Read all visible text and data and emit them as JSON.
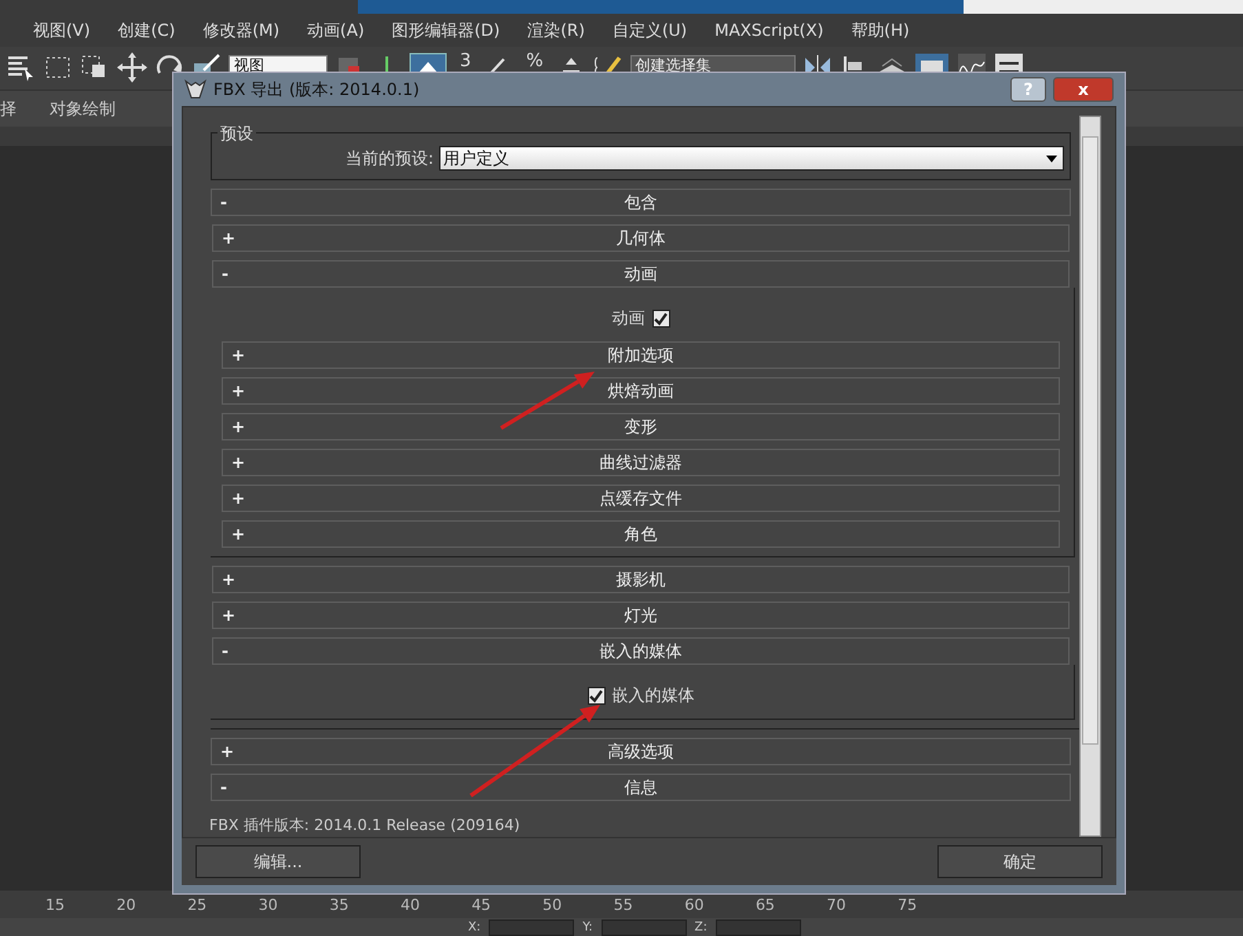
{
  "app": {
    "menu": [
      "视图(V)",
      "创建(C)",
      "修改器(M)",
      "动画(A)",
      "图形编辑器(D)",
      "渲染(R)",
      "自定义(U)",
      "MAXScript(X)",
      "帮助(H)"
    ],
    "toolbar": {
      "view_dropdown": "视图",
      "snap_label": "3",
      "percent_label": "%",
      "selection_set": "创建选择集"
    },
    "ribbon_tabs": [
      "择",
      "对象绘制"
    ],
    "ruler": [
      "15",
      "20",
      "25",
      "30",
      "35",
      "40",
      "45",
      "50",
      "55",
      "60",
      "65",
      "70",
      "75"
    ],
    "status_fields": [
      "X:",
      "Y:",
      "Z:"
    ]
  },
  "dialog": {
    "title": "FBX 导出 (版本: 2014.0.1)",
    "help": "?",
    "close": "x",
    "preset": {
      "group_label": "预设",
      "label": "当前的预设:",
      "value": "用户定义"
    },
    "rollouts": [
      {
        "toggle": "-",
        "title": "包含",
        "expanded": true,
        "children": [
          {
            "toggle": "+",
            "title": "几何体",
            "expanded": false
          },
          {
            "toggle": "-",
            "title": "动画",
            "expanded": true,
            "content": [
              {
                "kind": "trailingcheckbox",
                "label": "动画",
                "checked": true
              }
            ],
            "children": [
              {
                "toggle": "+",
                "title": "附加选项",
                "expanded": false
              },
              {
                "toggle": "+",
                "title": "烘焙动画",
                "expanded": false
              },
              {
                "toggle": "+",
                "title": "变形",
                "expanded": false
              },
              {
                "toggle": "+",
                "title": "曲线过滤器",
                "expanded": false
              },
              {
                "toggle": "+",
                "title": "点缓存文件",
                "expanded": false
              },
              {
                "toggle": "+",
                "title": "角色",
                "expanded": false
              }
            ]
          },
          {
            "toggle": "+",
            "title": "摄影机",
            "expanded": false
          },
          {
            "toggle": "+",
            "title": "灯光",
            "expanded": false
          },
          {
            "toggle": "-",
            "title": "嵌入的媒体",
            "expanded": true,
            "content": [
              {
                "kind": "checkbox",
                "label": "嵌入的媒体",
                "checked": true
              }
            ]
          }
        ]
      },
      {
        "toggle": "+",
        "title": "高级选项",
        "expanded": false
      },
      {
        "toggle": "-",
        "title": "信息",
        "expanded": true,
        "content": [
          {
            "kind": "text",
            "text": "FBX 插件版本: 2014.0.1 Release (209164)"
          }
        ]
      }
    ],
    "buttons": [
      "编辑...",
      "确定"
    ]
  }
}
